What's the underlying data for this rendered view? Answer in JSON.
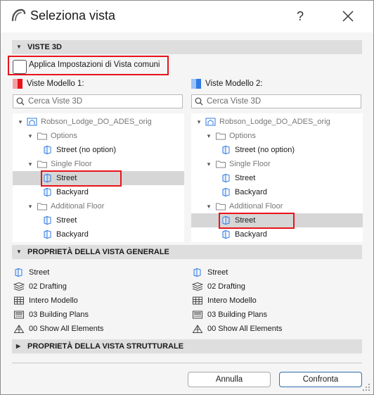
{
  "window": {
    "title": "Seleziona vista",
    "help": "?"
  },
  "sections": {
    "views3d": "VISTE 3D",
    "general": "PROPRIETÀ DELLA VISTA GENERALE",
    "structural": "PROPRIETÀ DELLA VISTA STRUTTURALE"
  },
  "apply_common": {
    "label": "Applica Impostazioni di Vista comuni",
    "checked": false
  },
  "model1": {
    "header": "Viste Modello 1:",
    "color": "#e8141c",
    "search_placeholder": "Cerca Viste 3D",
    "tree": [
      {
        "label": "Robson_Lodge_DO_ADES_orig",
        "kind": "project",
        "level": 0,
        "expanded": true
      },
      {
        "label": "Options",
        "kind": "folder",
        "level": 1,
        "expanded": true
      },
      {
        "label": "Street (no option)",
        "kind": "view",
        "level": 2
      },
      {
        "label": "Single Floor",
        "kind": "folder",
        "level": 1,
        "expanded": true
      },
      {
        "label": "Street",
        "kind": "view",
        "level": 2,
        "selected": true
      },
      {
        "label": "Backyard",
        "kind": "view",
        "level": 2
      },
      {
        "label": "Additional Floor",
        "kind": "folder",
        "level": 1,
        "expanded": true
      },
      {
        "label": "Street",
        "kind": "view",
        "level": 2
      },
      {
        "label": "Backyard",
        "kind": "view",
        "level": 2
      }
    ],
    "properties": [
      {
        "icon": "view-icon",
        "label": "Street"
      },
      {
        "icon": "layers-icon",
        "label": "02 Drafting"
      },
      {
        "icon": "model-filter-icon",
        "label": "Intero Modello"
      },
      {
        "icon": "pen-set-icon",
        "label": "03 Building Plans"
      },
      {
        "icon": "structure-icon",
        "label": "00 Show All Elements"
      }
    ]
  },
  "model2": {
    "header": "Viste Modello 2:",
    "color": "#2f7ae5",
    "search_placeholder": "Cerca Viste 3D",
    "tree": [
      {
        "label": "Robson_Lodge_DO_ADES_orig",
        "kind": "project",
        "level": 0,
        "expanded": true
      },
      {
        "label": "Options",
        "kind": "folder",
        "level": 1,
        "expanded": true
      },
      {
        "label": "Street (no option)",
        "kind": "view",
        "level": 2
      },
      {
        "label": "Single Floor",
        "kind": "folder",
        "level": 1,
        "expanded": true
      },
      {
        "label": "Street",
        "kind": "view",
        "level": 2
      },
      {
        "label": "Backyard",
        "kind": "view",
        "level": 2
      },
      {
        "label": "Additional Floor",
        "kind": "folder",
        "level": 1,
        "expanded": true
      },
      {
        "label": "Street",
        "kind": "view",
        "level": 2,
        "selected": true
      },
      {
        "label": "Backyard",
        "kind": "view",
        "level": 2
      }
    ],
    "properties": [
      {
        "icon": "view-icon",
        "label": "Street"
      },
      {
        "icon": "layers-icon",
        "label": "02 Drafting"
      },
      {
        "icon": "model-filter-icon",
        "label": "Intero Modello"
      },
      {
        "icon": "pen-set-icon",
        "label": "03 Building Plans"
      },
      {
        "icon": "structure-icon",
        "label": "00 Show All Elements"
      }
    ]
  },
  "buttons": {
    "cancel": "Annulla",
    "compare": "Confronta"
  },
  "colors": {
    "highlight": "#e8141c",
    "primary_border": "#2f6fb0",
    "selection": "#d6d6d6"
  }
}
